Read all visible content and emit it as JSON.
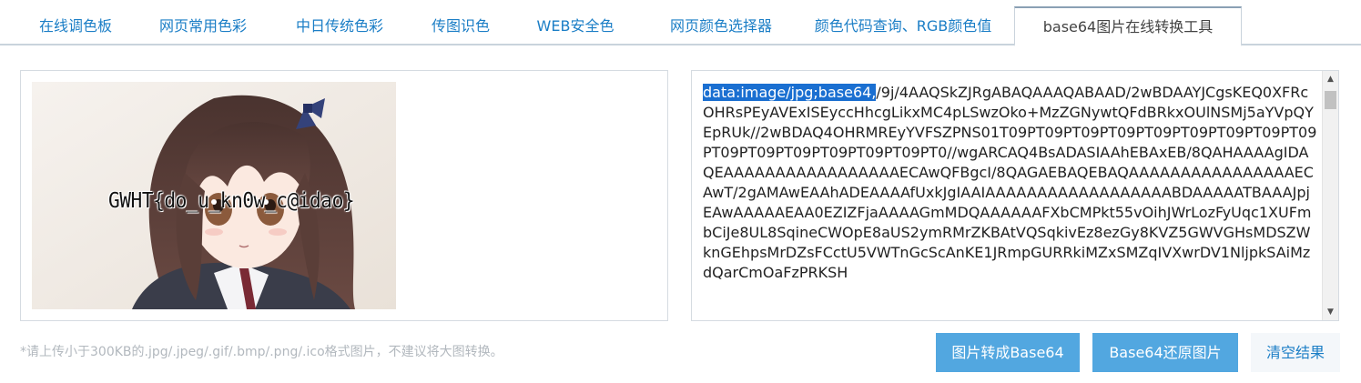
{
  "tabs": [
    {
      "label": "在线调色板"
    },
    {
      "label": "网页常用色彩"
    },
    {
      "label": "中日传统色彩"
    },
    {
      "label": "传图识色"
    },
    {
      "label": "WEB安全色"
    },
    {
      "label": "网页颜色选择器"
    },
    {
      "label": "颜色代码查询、RGB颜色值"
    },
    {
      "label": "base64图片在线转换工具"
    }
  ],
  "active_tab": "base64图片在线转换工具",
  "preview": {
    "flag_text": "GWHT{do_u_kn0w_c@idao}"
  },
  "output": {
    "selected_prefix": "data:image/jpg;base64,",
    "rest": "/9j/4AAQSkZJRgABAQAAAQABAAD/2wBDAAYJCgsKEQ0XFRcOHRsPEyAVExISEyccHhcgLikxMC4pLSwzOko+MzZGNywtQFdBRkxOUlNSMj5aYVpQYEpRUk//2wBDAQ4OHRMREyYVFSZPNS01T09PT09PT09PT09PT09PT09PT09PT09PT09PT09PT09PT09PT09PT09PT09PT0//wgARCAQ4BsADASIAAhEBAxEB/8QAHAAAAgIDAQEAAAAAAAAAAAAAAAAAECAwQFBgcI/8QAGAEBAQEBAQAAAAAAAAAAAAAAAAECAwT/2gAMAwEAAhADEAAAAfUxkJgIAAIAAAAAAAAAAAAAAAAAABDAAAAATBAAAJpjEAwAAAAAEAA0EZIZFjaAAAAGmMDQAAAAAAFXbCMPkt55vOihJWrLozFyUqc1XUFmbCiJe8UL8SqineCWOpE8aUS2ymRMrZKBAtVQSqkivEz8ezGy8KVZ5GWVGHsMDSZWknGEhpsMrDZsFCctU5VWTnGcScAnKE1JRmpGURRkiMZxSMZqIVXwrDV1NljpkSAiMzdQarCmOaFzPRKSH"
  },
  "hint": "*请上传小于300KB的.jpg/.jpeg/.gif/.bmp/.png/.ico格式图片，不建议将大图转换。",
  "buttons": {
    "to_base64": "图片转成Base64",
    "to_image": "Base64还原图片",
    "clear": "清空结果"
  },
  "colors": {
    "accent": "#52a7e0",
    "link": "#1b7ec6",
    "selection": "#1a6fd1"
  }
}
